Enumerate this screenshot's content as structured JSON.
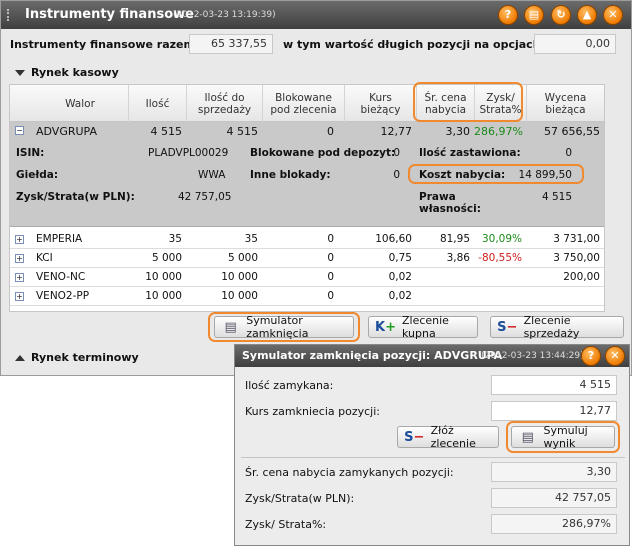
{
  "window": {
    "title": "Instrumenty finansowe",
    "timestamp": "(2012-03-23 13:19:39)",
    "buttons": [
      "?",
      "▤",
      "↻",
      "▲",
      "✕"
    ]
  },
  "summary": {
    "total_label": "Instrumenty finansowe razem:",
    "total_value": "65 337,55",
    "options_label": "w tym wartość długich pozycji na opcjach:",
    "options_value": "0,00"
  },
  "sections": {
    "cash": "Rynek kasowy",
    "futures": "Rynek terminowy"
  },
  "table": {
    "headers": {
      "walor": "Walor",
      "ilosc": "Ilość",
      "ilosc_sprz_1": "Ilość do",
      "ilosc_sprz_2": "sprzedaży",
      "blok_1": "Blokowane",
      "blok_2": "pod zlecenia",
      "kurs_1": "Kurs",
      "kurs_2": "bieżący",
      "sr_1": "Śr. cena",
      "sr_2": "nabycia",
      "zysk_1": "Zysk/",
      "zysk_2": "Strata%",
      "wyc_1": "Wycena",
      "wyc_2": "bieżąca"
    },
    "expanded": {
      "walor": "ADVGRUPA",
      "ilosc": "4 515",
      "ilosc_sprz": "4 515",
      "blok": "0",
      "kurs": "12,77",
      "sr": "3,30",
      "zysk": "286,97%",
      "wycena": "57 656,55"
    },
    "detail": {
      "isin_label": "ISIN:",
      "isin_value": "PLADVPL00029",
      "blok_depozyt_label": "Blokowane pod depozyt:",
      "blok_depozyt_value": "0",
      "ilosc_zast_label": "Ilość zastawiona:",
      "ilosc_zast_value": "0",
      "gielda_label": "Giełda:",
      "gielda_value": "WWA",
      "inne_label": "Inne blokady:",
      "inne_value": "0",
      "koszt_label": "Koszt nabycia:",
      "koszt_value": "14 899,50",
      "zysk_pln_label": "Zysk/Strata(w PLN):",
      "zysk_pln_value": "42 757,05",
      "prawa_label_1": "Prawa",
      "prawa_label_2": "własności:",
      "prawa_value": "4 515"
    },
    "rows": [
      {
        "walor": "EMPERIA",
        "ilosc": "35",
        "ilosc_sprz": "35",
        "blok": "0",
        "kurs": "106,60",
        "sr": "81,95",
        "zysk": "30,09%",
        "wycena": "3 731,00"
      },
      {
        "walor": "KCI",
        "ilosc": "5 000",
        "ilosc_sprz": "5 000",
        "blok": "0",
        "kurs": "0,75",
        "sr": "3,86",
        "zysk": "-80,55%",
        "wycena": "3 750,00"
      },
      {
        "walor": "VENO-NC",
        "ilosc": "10 000",
        "ilosc_sprz": "10 000",
        "blok": "0",
        "kurs": "0,02",
        "sr": "",
        "zysk": "",
        "wycena": "200,00"
      },
      {
        "walor": "VENO2-PP",
        "ilosc": "10 000",
        "ilosc_sprz": "10 000",
        "blok": "0",
        "kurs": "0,02",
        "sr": "",
        "zysk": "",
        "wycena": ""
      }
    ]
  },
  "actions": {
    "simulator": "Symulator zamknięcia",
    "buy": "Zlecenie kupna",
    "sell": "Zlecenie sprzedaży"
  },
  "simulator": {
    "title": "Symulator zamknięcia pozycji: ADVGRUPA",
    "timestamp": "(2012-03-23 13:44:29)",
    "qty_label": "Ilość zamykana:",
    "qty_value": "4 515",
    "price_label": "Kurs zamkniecia pozycji:",
    "price_value": "12,77",
    "order_button": "Złóż zlecenie",
    "simulate_button": "Symuluj wynik",
    "avg_label": "Śr. cena nabycia zamykanych pozycji:",
    "avg_value": "3,30",
    "pln_label": "Zysk/Strata(w PLN):",
    "pln_value": "42 757,05",
    "pct_label": "Zysk/ Strata%:",
    "pct_value": "286,97%"
  },
  "colors": {
    "highlight": "#f08a30",
    "gain": "#1a8a1a",
    "loss": "#d02020",
    "titlebar": "#4a4a4a"
  }
}
